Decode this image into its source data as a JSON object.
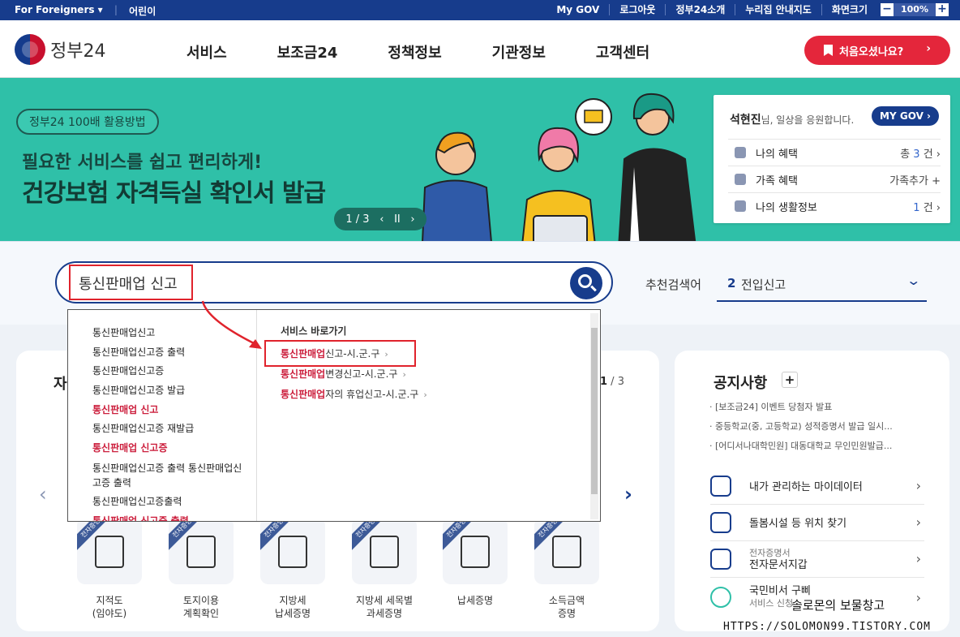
{
  "topbar": {
    "foreigners": "For Foreigners ▾",
    "kids": "어린이",
    "links": [
      "My GOV",
      "로그아웃",
      "정부24소개",
      "누리집 안내지도"
    ],
    "zoom_label": "화면크기",
    "zoom_minus": "−",
    "zoom_value": "100%",
    "zoom_plus": "+"
  },
  "header": {
    "logo_text": "정부24",
    "nav": [
      "서비스",
      "보조금24",
      "정책정보",
      "기관정보",
      "고객센터"
    ],
    "first_visit": "처음오셨나요?",
    "first_visit_chevron": "›"
  },
  "banner": {
    "pill": "정부24 100배 활용방법",
    "subtitle": "필요한 서비스를 쉽고 편리하게!",
    "title": "건강보험 자격득실 확인서 발급",
    "pager_text": "1 / 3",
    "pager_prev": "‹",
    "pager_pause": "II",
    "pager_next": "›",
    "colors": {
      "bg": "#2fc0a8"
    }
  },
  "mygov": {
    "name": "석현진",
    "greeting": "님, 일상을 응원합니다.",
    "button": "MY GOV ›",
    "rows": [
      {
        "label": "나의 혜택",
        "prefix": "총 ",
        "count": "3",
        "suffix": " 건 ›"
      },
      {
        "label": "가족 혜택",
        "prefix": "",
        "count": "",
        "suffix": "가족추가 +"
      },
      {
        "label": "나의 생활정보",
        "prefix": "",
        "count": "1",
        "suffix": " 건 ›"
      }
    ]
  },
  "search": {
    "query": "통신판매업 신고",
    "recommend_label": "추천검색어",
    "recommend_rank": "2",
    "recommend_value": "전입신고",
    "recommend_chevron": "⌄"
  },
  "autocomplete": {
    "suggestions": [
      {
        "text": "통신판매업신고",
        "highlight": false
      },
      {
        "text": "통신판매업신고증 출력",
        "highlight": false
      },
      {
        "text": "통신판매업신고증",
        "highlight": false
      },
      {
        "text": "통신판매업신고증 발급",
        "highlight": false
      },
      {
        "text": "통신판매업 신고",
        "highlight": true
      },
      {
        "text": "통신판매업신고증 재발급",
        "highlight": false
      },
      {
        "text": "통신판매업 신고증",
        "highlight": true
      },
      {
        "text": "통신판매업신고증 출력 통신판매업신고증 출력",
        "highlight": false,
        "multiline": true
      },
      {
        "text": "통신판매업신고증출력",
        "highlight": false
      },
      {
        "text": "통신판매업 신고증 출력",
        "highlight": true
      }
    ],
    "shortcut_header": "서비스 바로가기",
    "shortcuts": [
      {
        "keyword": "통신판매업",
        "rest": "신고-시.군.구",
        "arrow": "›"
      },
      {
        "keyword": "통신판매업",
        "rest": "변경신고-시.군.구",
        "arrow": "›"
      },
      {
        "keyword": "통신판매업",
        "rest": "자의 휴업신고-시.군.구",
        "arrow": "›"
      }
    ]
  },
  "services_card": {
    "title_partial": "자",
    "page_current": "1",
    "page_total": " / 3",
    "prev": "‹",
    "next": "›",
    "ribbon": "전자증명",
    "items": [
      {
        "label1": "지적도",
        "label2": "(임야도)",
        "icon": "map-magnifier-icon"
      },
      {
        "label1": "토지이용",
        "label2": "계획확인",
        "icon": "map-pin-icon"
      },
      {
        "label1": "지방세",
        "label2": "납세증명",
        "icon": "document-icon"
      },
      {
        "label1": "지방세 세목별",
        "label2": "과세증명",
        "icon": "chart-search-icon"
      },
      {
        "label1": "납세증명",
        "label2": "",
        "icon": "coin-document-icon"
      },
      {
        "label1": "소득금액",
        "label2": "증명",
        "icon": "coin-stack-icon"
      }
    ]
  },
  "notice": {
    "title": "공지사항",
    "plus": "+",
    "items": [
      "· [보조금24] 이벤트 당첨자 발표",
      "· 중등학교(중, 고등학교) 성적증명서 발급 일시...",
      "· [어디서나대학민원] 대동대학교 무인민원발급..."
    ],
    "quick": [
      {
        "text": "내가 관리하는 마이데이터",
        "small": "",
        "icon": "database-icon"
      },
      {
        "text": "돌봄시설 등 위치 찾기",
        "small": "",
        "icon": "location-pin-icon"
      },
      {
        "text": "전자문서지갑",
        "small": "전자증명서",
        "icon": "phone-wallet-icon"
      },
      {
        "text": "서비스 신청",
        "small": "국민비서 구삐",
        "icon": "bird-mascot-icon"
      }
    ],
    "chevron": "›"
  },
  "watermark": {
    "text": "솔로몬의 보물창고",
    "url": "HTTPS://SOLOMON99.TISTORY.COM"
  }
}
